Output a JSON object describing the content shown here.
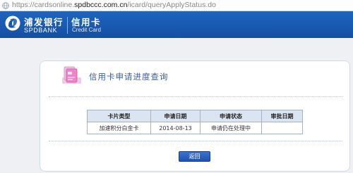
{
  "browser": {
    "url_prefix": "https://cardsonline.",
    "url_domain": "spdbccc.com.cn",
    "url_path": "/icard/queryApplyStatus.do"
  },
  "header": {
    "bank_name": "浦发银行",
    "bank_name_en": "SPDBANK",
    "product_name": "信用卡",
    "product_name_en": "Credit Card"
  },
  "panel": {
    "title": "信用卡申请进度查询"
  },
  "table": {
    "columns": [
      "卡片类型",
      "申请日期",
      "申请状态",
      "审批日期"
    ],
    "rows": [
      [
        "加速积分白金卡",
        "2014-08-13",
        "申请仍在处理中",
        ""
      ]
    ]
  },
  "actions": {
    "back_label": "返回"
  },
  "colors": {
    "header_blue": "#1858b0",
    "title_blue": "#3a5f9f",
    "table_header": "#dbe5f2",
    "button_blue": "#2a62c0"
  }
}
